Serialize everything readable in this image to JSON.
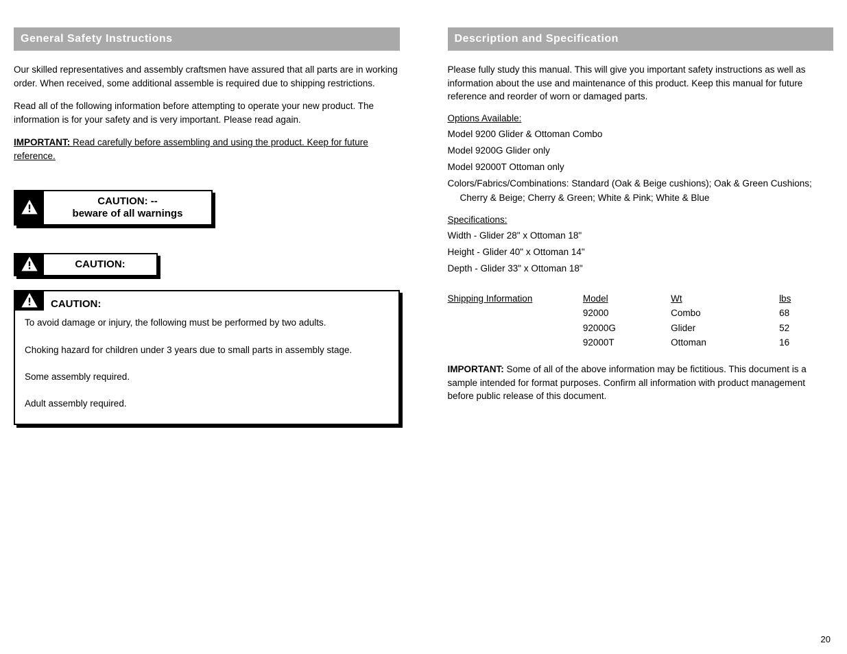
{
  "left": {
    "header": "General Safety Instructions",
    "p1": "Our skilled representatives and assembly craftsmen have assured that all parts are in working order. When received, some additional assemble is required due to shipping restrictions.",
    "p2": "Read all of the following information before attempting to operate your new product. The information is for your safety and is very important. Please read again.",
    "p3_prefix": "IMPORTANT: ",
    "p3_rest": "Read carefully before assembling and using the product. Keep for future reference.",
    "caution1_line1": "CAUTION: --",
    "caution1_line2": "beware of all warnings",
    "caution2": "CAUTION:",
    "box_heading": "CAUTION:",
    "box_p1": "To avoid damage or injury, the following must be performed by two adults.",
    "box_p2": "Choking hazard for children under 3 years due to small parts in assembly stage.",
    "box_p3": "Some assembly required.",
    "box_p4": "Adult assembly required."
  },
  "right": {
    "header": "Description and Specification",
    "p1": "Please fully study this manual. This will give you important safety instructions as well as information about the use and maintenance of this product. Keep this manual for future reference and reorder of worn or damaged parts.",
    "options_head": "Options Available:",
    "options": [
      "Model 9200 Glider & Ottoman Combo",
      "Model 9200G Glider only",
      "Model 92000T Ottoman only",
      "Colors/Fabrics/Combinations: Standard (Oak & Beige cushions); Oak & Green Cushions; Cherry & Beige; Cherry & Green; White & Pink; White & Blue"
    ],
    "specs_head": "Specifications:",
    "specs": [
      "Width - Glider 28\" x Ottoman 18\"",
      "Height - Glider 40\" x Ottoman 14\"",
      "Depth - Glider 33\" x Ottoman 18\""
    ],
    "table": {
      "headers": [
        "Shipping Information",
        "Model",
        "Wt",
        "lbs"
      ],
      "rows": [
        [
          "",
          "92000",
          "Combo",
          "68"
        ],
        [
          "",
          "92000G",
          "Glider",
          "52"
        ],
        [
          "",
          "92000T",
          "Ottoman",
          "16"
        ]
      ]
    },
    "note_prefix": "IMPORTANT:",
    "note_rest": " Some of all of the above information may be fictitious. This document is a sample intended for format purposes. Confirm all information with product management before public release of this document."
  },
  "page_number": "20"
}
